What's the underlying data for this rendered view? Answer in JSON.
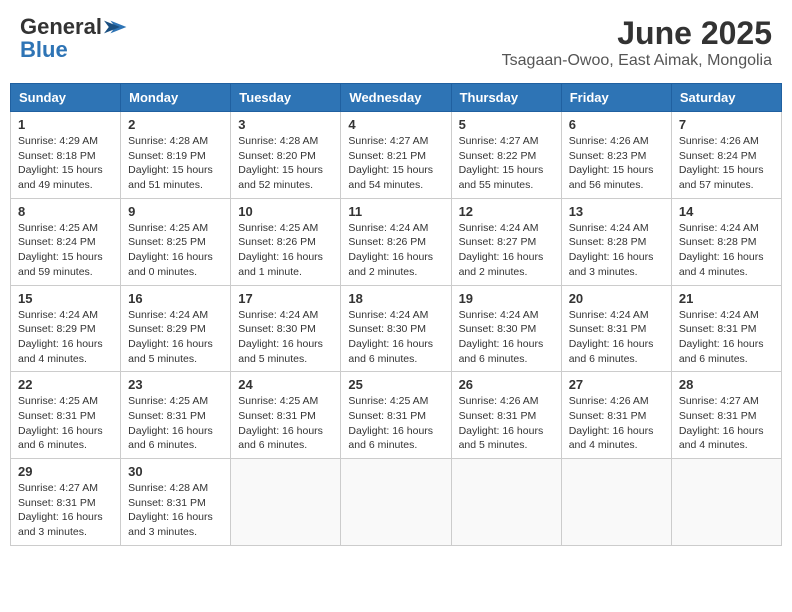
{
  "header": {
    "logo_line1": "General",
    "logo_line2": "Blue",
    "title": "June 2025",
    "subtitle": "Tsagaan-Owoo, East Aimak, Mongolia"
  },
  "days_of_week": [
    "Sunday",
    "Monday",
    "Tuesday",
    "Wednesday",
    "Thursday",
    "Friday",
    "Saturday"
  ],
  "weeks": [
    [
      {
        "day": "1",
        "sunrise": "4:29 AM",
        "sunset": "8:18 PM",
        "daylight": "15 hours and 49 minutes."
      },
      {
        "day": "2",
        "sunrise": "4:28 AM",
        "sunset": "8:19 PM",
        "daylight": "15 hours and 51 minutes."
      },
      {
        "day": "3",
        "sunrise": "4:28 AM",
        "sunset": "8:20 PM",
        "daylight": "15 hours and 52 minutes."
      },
      {
        "day": "4",
        "sunrise": "4:27 AM",
        "sunset": "8:21 PM",
        "daylight": "15 hours and 54 minutes."
      },
      {
        "day": "5",
        "sunrise": "4:27 AM",
        "sunset": "8:22 PM",
        "daylight": "15 hours and 55 minutes."
      },
      {
        "day": "6",
        "sunrise": "4:26 AM",
        "sunset": "8:23 PM",
        "daylight": "15 hours and 56 minutes."
      },
      {
        "day": "7",
        "sunrise": "4:26 AM",
        "sunset": "8:24 PM",
        "daylight": "15 hours and 57 minutes."
      }
    ],
    [
      {
        "day": "8",
        "sunrise": "4:25 AM",
        "sunset": "8:24 PM",
        "daylight": "15 hours and 59 minutes."
      },
      {
        "day": "9",
        "sunrise": "4:25 AM",
        "sunset": "8:25 PM",
        "daylight": "16 hours and 0 minutes."
      },
      {
        "day": "10",
        "sunrise": "4:25 AM",
        "sunset": "8:26 PM",
        "daylight": "16 hours and 1 minute."
      },
      {
        "day": "11",
        "sunrise": "4:24 AM",
        "sunset": "8:26 PM",
        "daylight": "16 hours and 2 minutes."
      },
      {
        "day": "12",
        "sunrise": "4:24 AM",
        "sunset": "8:27 PM",
        "daylight": "16 hours and 2 minutes."
      },
      {
        "day": "13",
        "sunrise": "4:24 AM",
        "sunset": "8:28 PM",
        "daylight": "16 hours and 3 minutes."
      },
      {
        "day": "14",
        "sunrise": "4:24 AM",
        "sunset": "8:28 PM",
        "daylight": "16 hours and 4 minutes."
      }
    ],
    [
      {
        "day": "15",
        "sunrise": "4:24 AM",
        "sunset": "8:29 PM",
        "daylight": "16 hours and 4 minutes."
      },
      {
        "day": "16",
        "sunrise": "4:24 AM",
        "sunset": "8:29 PM",
        "daylight": "16 hours and 5 minutes."
      },
      {
        "day": "17",
        "sunrise": "4:24 AM",
        "sunset": "8:30 PM",
        "daylight": "16 hours and 5 minutes."
      },
      {
        "day": "18",
        "sunrise": "4:24 AM",
        "sunset": "8:30 PM",
        "daylight": "16 hours and 6 minutes."
      },
      {
        "day": "19",
        "sunrise": "4:24 AM",
        "sunset": "8:30 PM",
        "daylight": "16 hours and 6 minutes."
      },
      {
        "day": "20",
        "sunrise": "4:24 AM",
        "sunset": "8:31 PM",
        "daylight": "16 hours and 6 minutes."
      },
      {
        "day": "21",
        "sunrise": "4:24 AM",
        "sunset": "8:31 PM",
        "daylight": "16 hours and 6 minutes."
      }
    ],
    [
      {
        "day": "22",
        "sunrise": "4:25 AM",
        "sunset": "8:31 PM",
        "daylight": "16 hours and 6 minutes."
      },
      {
        "day": "23",
        "sunrise": "4:25 AM",
        "sunset": "8:31 PM",
        "daylight": "16 hours and 6 minutes."
      },
      {
        "day": "24",
        "sunrise": "4:25 AM",
        "sunset": "8:31 PM",
        "daylight": "16 hours and 6 minutes."
      },
      {
        "day": "25",
        "sunrise": "4:25 AM",
        "sunset": "8:31 PM",
        "daylight": "16 hours and 6 minutes."
      },
      {
        "day": "26",
        "sunrise": "4:26 AM",
        "sunset": "8:31 PM",
        "daylight": "16 hours and 5 minutes."
      },
      {
        "day": "27",
        "sunrise": "4:26 AM",
        "sunset": "8:31 PM",
        "daylight": "16 hours and 4 minutes."
      },
      {
        "day": "28",
        "sunrise": "4:27 AM",
        "sunset": "8:31 PM",
        "daylight": "16 hours and 4 minutes."
      }
    ],
    [
      {
        "day": "29",
        "sunrise": "4:27 AM",
        "sunset": "8:31 PM",
        "daylight": "16 hours and 3 minutes."
      },
      {
        "day": "30",
        "sunrise": "4:28 AM",
        "sunset": "8:31 PM",
        "daylight": "16 hours and 3 minutes."
      },
      null,
      null,
      null,
      null,
      null
    ]
  ]
}
